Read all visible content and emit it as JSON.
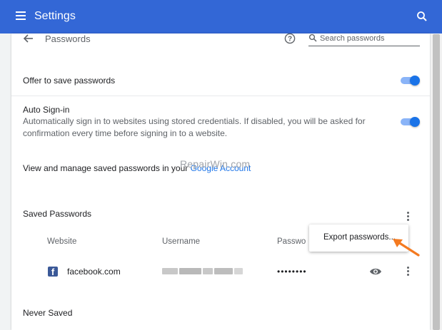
{
  "topbar": {
    "title": "Settings"
  },
  "page": {
    "title": "Passwords",
    "search_placeholder": "Search passwords"
  },
  "offer_save": {
    "label": "Offer to save passwords",
    "enabled": true
  },
  "auto_signin": {
    "label": "Auto Sign-in",
    "description_line1": "Automatically sign in to websites using stored credentials. If disabled, you will be asked for",
    "description_line2": "confirmation every time before signing in to a website.",
    "enabled": true
  },
  "manage": {
    "text": "View and manage saved passwords in your",
    "link": "Google Account"
  },
  "watermark": "RepairWin.com",
  "saved_passwords": {
    "heading": "Saved Passwords",
    "columns": {
      "website": "Website",
      "username": "Username",
      "password": "Passwo"
    },
    "menu": {
      "export_label": "Export passwords..."
    },
    "entries": [
      {
        "site": "facebook.com",
        "password_mask": "••••••••"
      }
    ]
  },
  "never_saved": {
    "heading": "Never Saved"
  },
  "colors": {
    "topbar": "#3367d6",
    "toggle_on": "#1a73e8",
    "arrow": "#f47a20"
  }
}
